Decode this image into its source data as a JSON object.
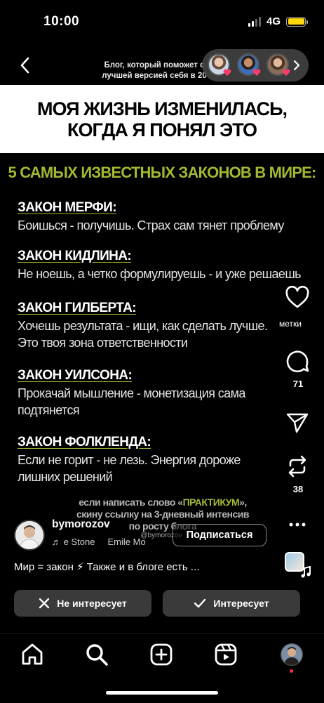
{
  "status_bar": {
    "time": "10:00",
    "network": "4G",
    "battery_level": 1.0,
    "battery_color": "#ffd60a"
  },
  "header": {
    "back_icon": "chevron-left-icon",
    "text": "Блог, который поможет с\nлучшей версией себя в 20",
    "more_icon": "chevron-right-icon"
  },
  "post": {
    "banner_title": "МОЯ ЖИЗНЬ ИЗМЕНИЛАСЬ,\nКОГДА Я ПОНЯЛ ЭТО",
    "laws_title": "5 САМЫХ ИЗВЕСТНЫХ ЗАКОНОВ В МИРЕ:",
    "accent_color": "#a3b832",
    "laws": [
      {
        "title": "ЗАКОН МЕРФИ:",
        "text": "Боишься - получишь. Страх сам тянет проблему"
      },
      {
        "title": "ЗАКОН КИДЛИНА:",
        "text": "Не ноешь, а четко формулируешь - и уже решаешь"
      },
      {
        "title": "ЗАКОН ГИЛБЕРТА:",
        "text": "Хочешь результата - ищи, как сделать лучше.\nЭто твоя зона ответственности"
      },
      {
        "title": "ЗАКОН УИЛСОНА:",
        "text": "Прокачай мышление - монетизация сама\nподтянется"
      },
      {
        "title": "ЗАКОН ФОЛКЛЕНДА:",
        "text": "Если не горит - не лезь. Энергия дороже\nлишних решений"
      }
    ],
    "cta_pre": "если написать слово «",
    "cta_word": "ПРАКТИКУМ",
    "cta_post": "»,\nскину ссылку на 3-дневный интенсив\nпо росту блога",
    "handle_small": "@bymorozov"
  },
  "actions": {
    "like_icon": "heart-icon",
    "like_label": "метки",
    "comment_icon": "comment-icon",
    "comment_count": "71",
    "share_icon": "send-icon",
    "repost_icon": "repost-icon",
    "repost_count": "38",
    "more_icon": "more-icon"
  },
  "author": {
    "name": "bymorozov",
    "music": "e Stone     Emile Mo",
    "subscribe_label": "Подписаться",
    "caption": "Мир = закон ⚡ Также и в блоге есть ..."
  },
  "feedback": {
    "not_interested": "Не интересует",
    "interested": "Интересует"
  },
  "nav": {
    "items": [
      "home-icon",
      "search-icon",
      "create-icon",
      "reels-icon",
      "profile-avatar"
    ]
  }
}
